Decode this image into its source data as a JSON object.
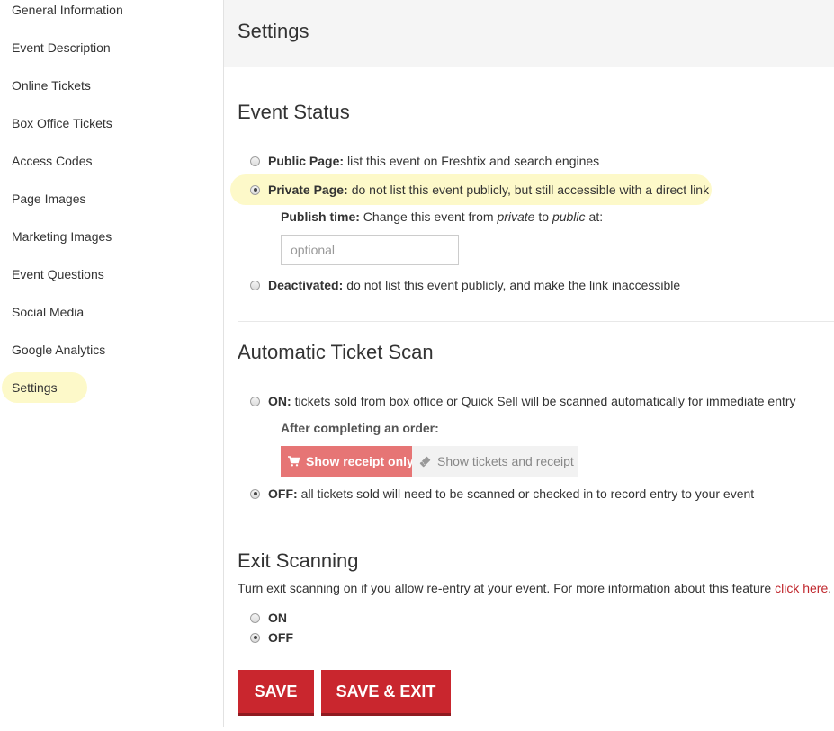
{
  "sidebar": {
    "items": [
      {
        "label": "General Information"
      },
      {
        "label": "Event Description"
      },
      {
        "label": "Online Tickets"
      },
      {
        "label": "Box Office Tickets"
      },
      {
        "label": "Access Codes"
      },
      {
        "label": "Page Images"
      },
      {
        "label": "Marketing Images"
      },
      {
        "label": "Event Questions"
      },
      {
        "label": "Social Media"
      },
      {
        "label": "Google Analytics"
      },
      {
        "label": "Settings",
        "active": true
      }
    ]
  },
  "page_title": "Settings",
  "event_status": {
    "title": "Event Status",
    "public": {
      "label": "Public Page:",
      "text": "list this event on Freshtix and search engines",
      "checked": false
    },
    "private": {
      "label": "Private Page:",
      "text": "do not list this event publicly, but still accessible with a direct link",
      "checked": true
    },
    "publish_time": {
      "label": "Publish time:",
      "text_before": "Change this event from",
      "from": "private",
      "to_word": "to",
      "to": "public",
      "text_after": "at:",
      "placeholder": "optional",
      "value": ""
    },
    "deactivated": {
      "label": "Deactivated:",
      "text": "do not list this event publicly, and make the link inaccessible",
      "checked": false
    }
  },
  "auto_scan": {
    "title": "Automatic Ticket Scan",
    "on": {
      "label": "ON:",
      "text": "tickets sold from box office or Quick Sell will be scanned automatically for immediate entry",
      "checked": false
    },
    "after_label": "After completing an order:",
    "options": [
      {
        "label": "Show receipt only",
        "icon": "cart-icon",
        "active": true
      },
      {
        "label": "Show tickets and receipt",
        "icon": "ticket-icon",
        "active": false
      }
    ],
    "off": {
      "label": "OFF:",
      "text": "all tickets sold will need to be scanned or checked in to record entry to your event",
      "checked": true
    }
  },
  "exit_scanning": {
    "title": "Exit Scanning",
    "description": "Turn exit scanning on if you allow re-entry at your event. For more information about this feature",
    "link_text": "click here",
    "period": ".",
    "on_label": "ON",
    "off_label": "OFF",
    "selected": "OFF"
  },
  "buttons": {
    "save": "SAVE",
    "save_exit": "SAVE & EXIT"
  },
  "colors": {
    "accent": "#c9262e",
    "highlight": "#fdf9c9",
    "active_option": "#e67575"
  }
}
